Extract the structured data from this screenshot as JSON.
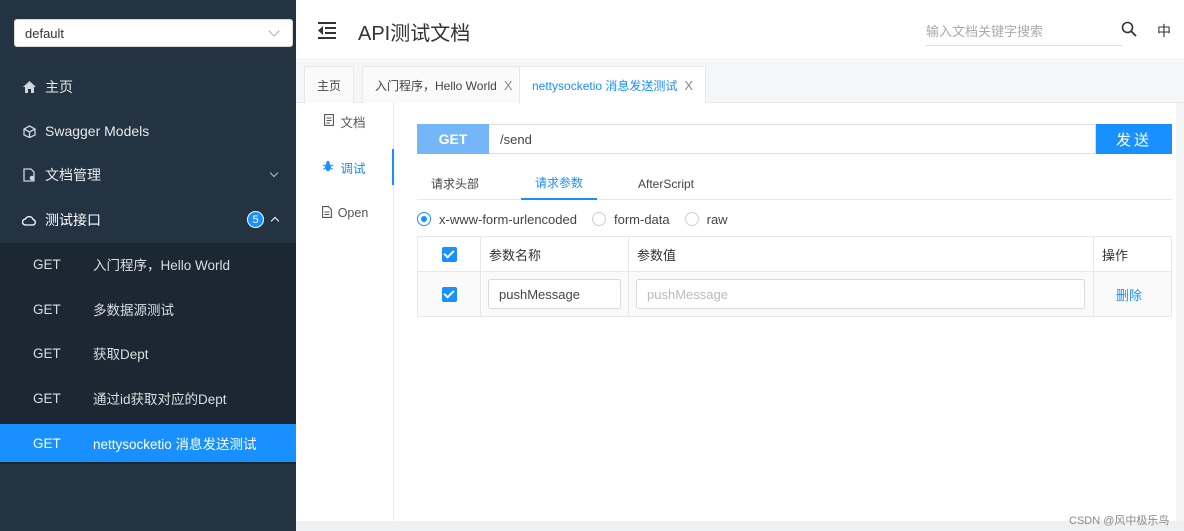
{
  "sidebar": {
    "group_select": "default",
    "menu": [
      {
        "label": "主页",
        "icon": "home-icon"
      },
      {
        "label": "Swagger Models",
        "icon": "cube-icon"
      },
      {
        "label": "文档管理",
        "icon": "document-settings-icon"
      },
      {
        "label": "测试接口",
        "icon": "cloud-icon",
        "badge": "5"
      }
    ],
    "apis": [
      {
        "method": "GET",
        "name": "入门程序，Hello World"
      },
      {
        "method": "GET",
        "name": "多数据源测试"
      },
      {
        "method": "GET",
        "name": "获取Dept"
      },
      {
        "method": "GET",
        "name": "通过id获取对应的Dept"
      },
      {
        "method": "GET",
        "name": "nettysocketio 消息发送测试"
      }
    ]
  },
  "header": {
    "title": "API测试文档",
    "search_placeholder": "输入文档关键字搜索",
    "lang": "中"
  },
  "tabs": [
    {
      "label": "主页"
    },
    {
      "label": "入门程序，Hello World",
      "close": "X"
    },
    {
      "label": "nettysocketio 消息发送测试",
      "close": "X"
    }
  ],
  "side_tabs": [
    {
      "label": "文档",
      "icon": "document-icon"
    },
    {
      "label": "调试",
      "icon": "bug-icon"
    },
    {
      "label": "Open",
      "icon": "file-icon"
    }
  ],
  "request": {
    "method": "GET",
    "url": "/send",
    "send_label": "发送"
  },
  "param_tabs": [
    "请求头部",
    "请求参数",
    "AfterScript"
  ],
  "content_types": [
    "x-www-form-urlencoded",
    "form-data",
    "raw"
  ],
  "params_table": {
    "headers": [
      "参数名称",
      "参数值",
      "操作"
    ],
    "rows": [
      {
        "name": "pushMessage",
        "value_placeholder": "pushMessage",
        "action": "删除"
      }
    ]
  },
  "watermark": "CSDN @风中极乐鸟",
  "colors": {
    "sidebar_bg": "#243342",
    "primary": "#1890ff",
    "method_bg": "#74b6f7"
  }
}
